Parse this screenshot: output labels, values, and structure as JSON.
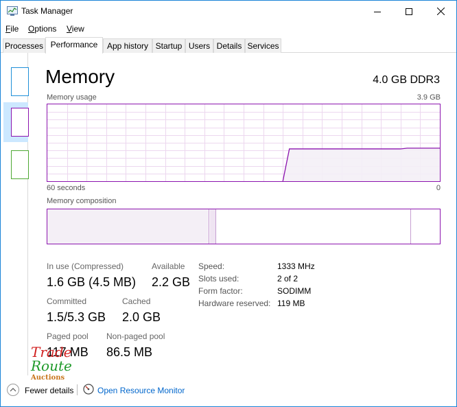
{
  "window": {
    "title": "Task Manager"
  },
  "menu": [
    {
      "acc": "F",
      "rest": "ile"
    },
    {
      "acc": "O",
      "rest": "ptions"
    },
    {
      "acc": "V",
      "rest": "iew"
    }
  ],
  "tabs": [
    "Processes",
    "Performance",
    "App history",
    "Startup",
    "Users",
    "Details",
    "Services"
  ],
  "active_tab": "Performance",
  "colors": {
    "accent": "#8b12ae",
    "fill": "#f4eff6",
    "grid": "#ecd7ef",
    "link": "#0066cc",
    "selection": "#cce8ff"
  },
  "memory": {
    "heading": "Memory",
    "total": "4.0 GB DDR3",
    "usage_label": "Memory usage",
    "usage_max": "3.9 GB",
    "time_left": "60 seconds",
    "time_right": "0",
    "composition_label": "Memory composition",
    "usage_fraction_history": [
      0,
      0,
      0,
      0,
      0,
      0,
      0,
      0,
      0,
      0,
      0,
      0,
      0,
      0,
      0,
      0,
      0,
      0,
      0,
      0,
      0,
      0,
      0,
      0,
      0,
      0,
      0,
      0,
      0,
      0,
      0,
      0,
      0,
      0,
      0,
      0,
      0,
      0.42,
      0.42,
      0.42,
      0.42,
      0.42,
      0.42,
      0.42,
      0.42,
      0.42,
      0.42,
      0.42,
      0.42,
      0.42,
      0.42,
      0.42,
      0.42,
      0.42,
      0.42,
      0.43,
      0.43,
      0.43,
      0.43,
      0.43,
      0.43
    ]
  },
  "stats": {
    "in_use_label": "In use (Compressed)",
    "in_use_value": "1.6 GB (4.5 MB)",
    "available_label": "Available",
    "available_value": "2.2 GB",
    "committed_label": "Committed",
    "committed_value": "1.5/5.3 GB",
    "cached_label": "Cached",
    "cached_value": "2.0 GB",
    "paged_label": "Paged pool",
    "paged_value": "117 MB",
    "nonpaged_label": "Non-paged pool",
    "nonpaged_value": "86.5 MB"
  },
  "details": [
    {
      "key": "Speed:",
      "value": "1333 MHz"
    },
    {
      "key": "Slots used:",
      "value": "2 of 2"
    },
    {
      "key": "Form factor:",
      "value": "SODIMM"
    },
    {
      "key": "Hardware reserved:",
      "value": "119 MB"
    }
  ],
  "watermark": {
    "line1": "Trade",
    "line2": "Route",
    "line3": "Auctions"
  },
  "footer": {
    "fewer_details": "Fewer details",
    "open_resource_monitor": "Open Resource Monitor"
  }
}
